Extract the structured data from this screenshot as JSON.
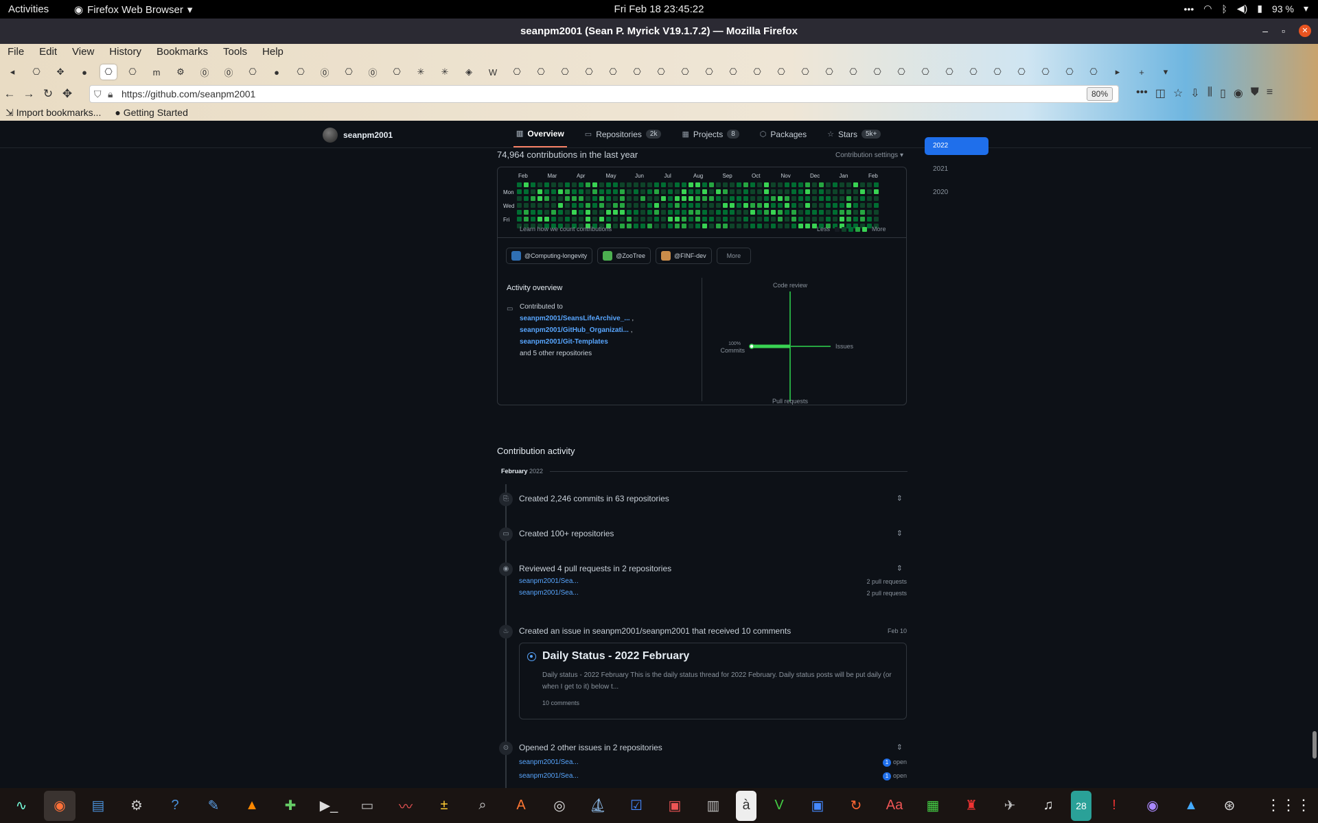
{
  "system": {
    "activities": "Activities",
    "app_menu": "Firefox Web Browser",
    "clock": "Fri Feb 18  23:45:22",
    "battery": "93 %"
  },
  "window": {
    "title": "seanpm2001 (Sean P. Myrick V19.1.7.2) — Mozilla Firefox"
  },
  "menu": [
    "File",
    "Edit",
    "View",
    "History",
    "Bookmarks",
    "Tools",
    "Help"
  ],
  "browser": {
    "url": "https://github.com/seanpm2001",
    "zoom": "80%",
    "bookmarks": [
      "Import bookmarks...",
      "Getting Started"
    ]
  },
  "profile": {
    "username": "seanpm2001",
    "tabs": [
      {
        "label": "Overview",
        "count": ""
      },
      {
        "label": "Repositories",
        "count": "2k"
      },
      {
        "label": "Projects",
        "count": "8"
      },
      {
        "label": "Packages",
        "count": ""
      },
      {
        "label": "Stars",
        "count": "5k+"
      }
    ]
  },
  "contributions": {
    "heading": "74,964 contributions in the last year",
    "settings": "Contribution settings",
    "months": [
      "Feb",
      "Mar",
      "Apr",
      "May",
      "Jun",
      "Jul",
      "Aug",
      "Sep",
      "Oct",
      "Nov",
      "Dec",
      "Jan",
      "Feb"
    ],
    "days": [
      "Mon",
      "Wed",
      "Fri"
    ],
    "learn": "Learn how we count contributions",
    "less": "Less",
    "more": "More",
    "level_colors": [
      "#0e4429",
      "#006d32",
      "#26a641",
      "#39d353"
    ]
  },
  "years": [
    "2022",
    "2021",
    "2020"
  ],
  "orgs": [
    {
      "label": "@Computing-longevity",
      "color": "#2f6fb3"
    },
    {
      "label": "@ZooTree",
      "color": "#4caf50"
    },
    {
      "label": "@FINF-dev",
      "color": "#c98c4a"
    }
  ],
  "orgs_more": "More",
  "activity": {
    "title": "Activity overview",
    "contributed_to": "Contributed to",
    "repos": [
      "seanpm2001/SeansLifeArchive_...",
      "seanpm2001/GitHub_Organizati...",
      "seanpm2001/Git-Templates"
    ],
    "others": "and 5 other repositories",
    "radar": {
      "code_review": "Code review",
      "issues": "Issues",
      "pull_requests": "Pull requests",
      "commits_pct": "100%",
      "commits": "Commits"
    }
  },
  "timeline": {
    "heading": "Contribution activity",
    "month": "February",
    "year": "2022",
    "items": [
      {
        "text": "Created 2,246 commits in 63 repositories"
      },
      {
        "text": "Created 100+ repositories"
      },
      {
        "text": "Reviewed 4 pull requests in 2 repositories",
        "rows": [
          {
            "repo": "seanpm2001/Sea...",
            "meta": "2 pull requests"
          },
          {
            "repo": "seanpm2001/Sea...",
            "meta": "2 pull requests"
          }
        ]
      },
      {
        "text": "Created an issue in seanpm2001/seanpm2001 that received 10 comments",
        "date": "Feb 10"
      },
      {
        "text": "Opened 2 other issues in 2 repositories",
        "rows": [
          {
            "repo": "seanpm2001/Sea...",
            "count": "1",
            "meta": "open"
          },
          {
            "repo": "seanpm2001/Sea...",
            "count": "1",
            "meta": "open"
          }
        ]
      }
    ],
    "issue": {
      "title": "Daily Status - 2022 February",
      "body": "Daily status - 2022 February This is the daily status thread for 2022 February. Daily status posts will be put daily (or when I get to it) below t...",
      "comments": "10 comments"
    }
  },
  "dock_badge": "28"
}
